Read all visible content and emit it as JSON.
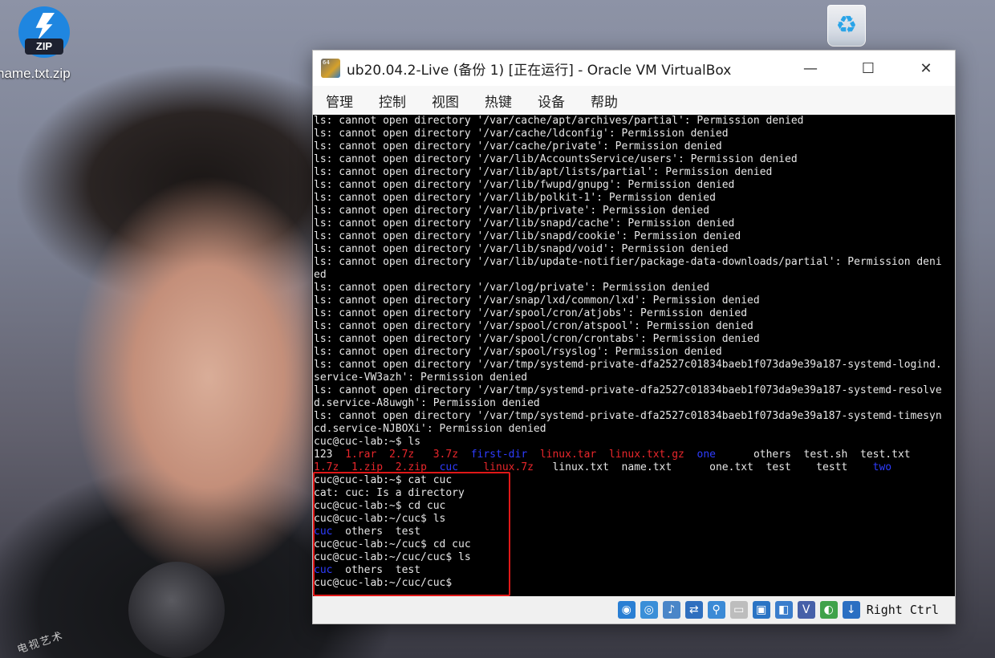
{
  "desktop": {
    "zip_icon": {
      "badge": "ZIP",
      "label": "name.txt.zip"
    },
    "recycle_bin": {
      "icon": "recycle-bin-icon"
    },
    "wallpaper_text": "电视艺术"
  },
  "window": {
    "title": "ub20.04.2-Live (备份 1) [正在运行] - Oracle VM VirtualBox",
    "app_icon_text": "64",
    "controls": {
      "minimize": "—",
      "maximize": "☐",
      "close": "✕"
    },
    "menu": [
      "管理",
      "控制",
      "视图",
      "热键",
      "设备",
      "帮助"
    ]
  },
  "colors": {
    "default": "#e6e6e6",
    "red": "#e8262b",
    "blue": "#2e3cff"
  },
  "terminal": {
    "lines": [
      [
        [
          "d",
          "ls: cannot open directory '/var/cache/apt/archives/partial': Permission denied"
        ]
      ],
      [
        [
          "d",
          "ls: cannot open directory '/var/cache/ldconfig': Permission denied"
        ]
      ],
      [
        [
          "d",
          "ls: cannot open directory '/var/cache/private': Permission denied"
        ]
      ],
      [
        [
          "d",
          "ls: cannot open directory '/var/lib/AccountsService/users': Permission denied"
        ]
      ],
      [
        [
          "d",
          "ls: cannot open directory '/var/lib/apt/lists/partial': Permission denied"
        ]
      ],
      [
        [
          "d",
          "ls: cannot open directory '/var/lib/fwupd/gnupg': Permission denied"
        ]
      ],
      [
        [
          "d",
          "ls: cannot open directory '/var/lib/polkit-1': Permission denied"
        ]
      ],
      [
        [
          "d",
          "ls: cannot open directory '/var/lib/private': Permission denied"
        ]
      ],
      [
        [
          "d",
          "ls: cannot open directory '/var/lib/snapd/cache': Permission denied"
        ]
      ],
      [
        [
          "d",
          "ls: cannot open directory '/var/lib/snapd/cookie': Permission denied"
        ]
      ],
      [
        [
          "d",
          "ls: cannot open directory '/var/lib/snapd/void': Permission denied"
        ]
      ],
      [
        [
          "d",
          "ls: cannot open directory '/var/lib/update-notifier/package-data-downloads/partial': Permission deni"
        ]
      ],
      [
        [
          "d",
          "ed"
        ]
      ],
      [
        [
          "d",
          "ls: cannot open directory '/var/log/private': Permission denied"
        ]
      ],
      [
        [
          "d",
          "ls: cannot open directory '/var/snap/lxd/common/lxd': Permission denied"
        ]
      ],
      [
        [
          "d",
          "ls: cannot open directory '/var/spool/cron/atjobs': Permission denied"
        ]
      ],
      [
        [
          "d",
          "ls: cannot open directory '/var/spool/cron/atspool': Permission denied"
        ]
      ],
      [
        [
          "d",
          "ls: cannot open directory '/var/spool/cron/crontabs': Permission denied"
        ]
      ],
      [
        [
          "d",
          "ls: cannot open directory '/var/spool/rsyslog': Permission denied"
        ]
      ],
      [
        [
          "d",
          "ls: cannot open directory '/var/tmp/systemd-private-dfa2527c01834baeb1f073da9e39a187-systemd-logind."
        ]
      ],
      [
        [
          "d",
          "service-VW3azh': Permission denied"
        ]
      ],
      [
        [
          "d",
          "ls: cannot open directory '/var/tmp/systemd-private-dfa2527c01834baeb1f073da9e39a187-systemd-resolve"
        ]
      ],
      [
        [
          "d",
          "d.service-A8uwgh': Permission denied"
        ]
      ],
      [
        [
          "d",
          "ls: cannot open directory '/var/tmp/systemd-private-dfa2527c01834baeb1f073da9e39a187-systemd-timesyn"
        ]
      ],
      [
        [
          "d",
          "cd.service-NJBOXi': Permission denied"
        ]
      ],
      [
        [
          "d",
          "cuc@cuc-lab:~$ ls"
        ]
      ],
      [
        [
          "d",
          "123  "
        ],
        [
          "r",
          "1.rar"
        ],
        [
          "d",
          "  "
        ],
        [
          "r",
          "2.7z"
        ],
        [
          "d",
          "   "
        ],
        [
          "r",
          "3.7z"
        ],
        [
          "d",
          "  "
        ],
        [
          "b",
          "first-dir"
        ],
        [
          "d",
          "  "
        ],
        [
          "r",
          "linux.tar"
        ],
        [
          "d",
          "  "
        ],
        [
          "r",
          "linux.txt.gz"
        ],
        [
          "d",
          "  "
        ],
        [
          "b",
          "one"
        ],
        [
          "d",
          "      others  test.sh  test.txt"
        ]
      ],
      [
        [
          "r",
          "1.7z"
        ],
        [
          "d",
          "  "
        ],
        [
          "r",
          "1.zip"
        ],
        [
          "d",
          "  "
        ],
        [
          "r",
          "2.zip"
        ],
        [
          "d",
          "  "
        ],
        [
          "b",
          "cuc"
        ],
        [
          "d",
          "    "
        ],
        [
          "r",
          "linux.7z"
        ],
        [
          "d",
          "   linux.txt  name.txt      one.txt  test    testt    "
        ],
        [
          "b",
          "two"
        ]
      ],
      [
        [
          "d",
          "cuc@cuc-lab:~$ cat cuc"
        ]
      ],
      [
        [
          "d",
          "cat: cuc: Is a directory"
        ]
      ],
      [
        [
          "d",
          "cuc@cuc-lab:~$ cd cuc"
        ]
      ],
      [
        [
          "d",
          "cuc@cuc-lab:~/cuc$ ls"
        ]
      ],
      [
        [
          "b",
          "cuc"
        ],
        [
          "d",
          "  others  test"
        ]
      ],
      [
        [
          "d",
          "cuc@cuc-lab:~/cuc$ cd cuc"
        ]
      ],
      [
        [
          "d",
          "cuc@cuc-lab:~/cuc/cuc$ ls"
        ]
      ],
      [
        [
          "b",
          "cuc"
        ],
        [
          "d",
          "  others  test"
        ]
      ],
      [
        [
          "d",
          "cuc@cuc-lab:~/cuc/cuc$ "
        ]
      ]
    ]
  },
  "statusbar": {
    "icons": [
      {
        "name": "optical-drive-icon",
        "glyph": "◉",
        "color": "#2a7fd4"
      },
      {
        "name": "cd-icon",
        "glyph": "◎",
        "color": "#3a8fd8"
      },
      {
        "name": "audio-icon",
        "glyph": "♪",
        "color": "#4a86c8"
      },
      {
        "name": "network-icon",
        "glyph": "⇄",
        "color": "#2f6fbf"
      },
      {
        "name": "usb-icon",
        "glyph": "⚲",
        "color": "#3b8ad6"
      },
      {
        "name": "shared-folders-icon",
        "glyph": "▭",
        "color": "#bdbdbd"
      },
      {
        "name": "display-icon",
        "glyph": "▣",
        "color": "#2a74c4"
      },
      {
        "name": "video-capture-icon",
        "glyph": "◧",
        "color": "#3a7dcc"
      },
      {
        "name": "recording-icon",
        "glyph": "V",
        "color": "#4660a8"
      },
      {
        "name": "mouse-integration-icon",
        "glyph": "◐",
        "color": "#3fa24a"
      },
      {
        "name": "keyboard-capture-icon",
        "glyph": "↓",
        "color": "#2a6fc2"
      }
    ],
    "host_key": "Right Ctrl"
  }
}
